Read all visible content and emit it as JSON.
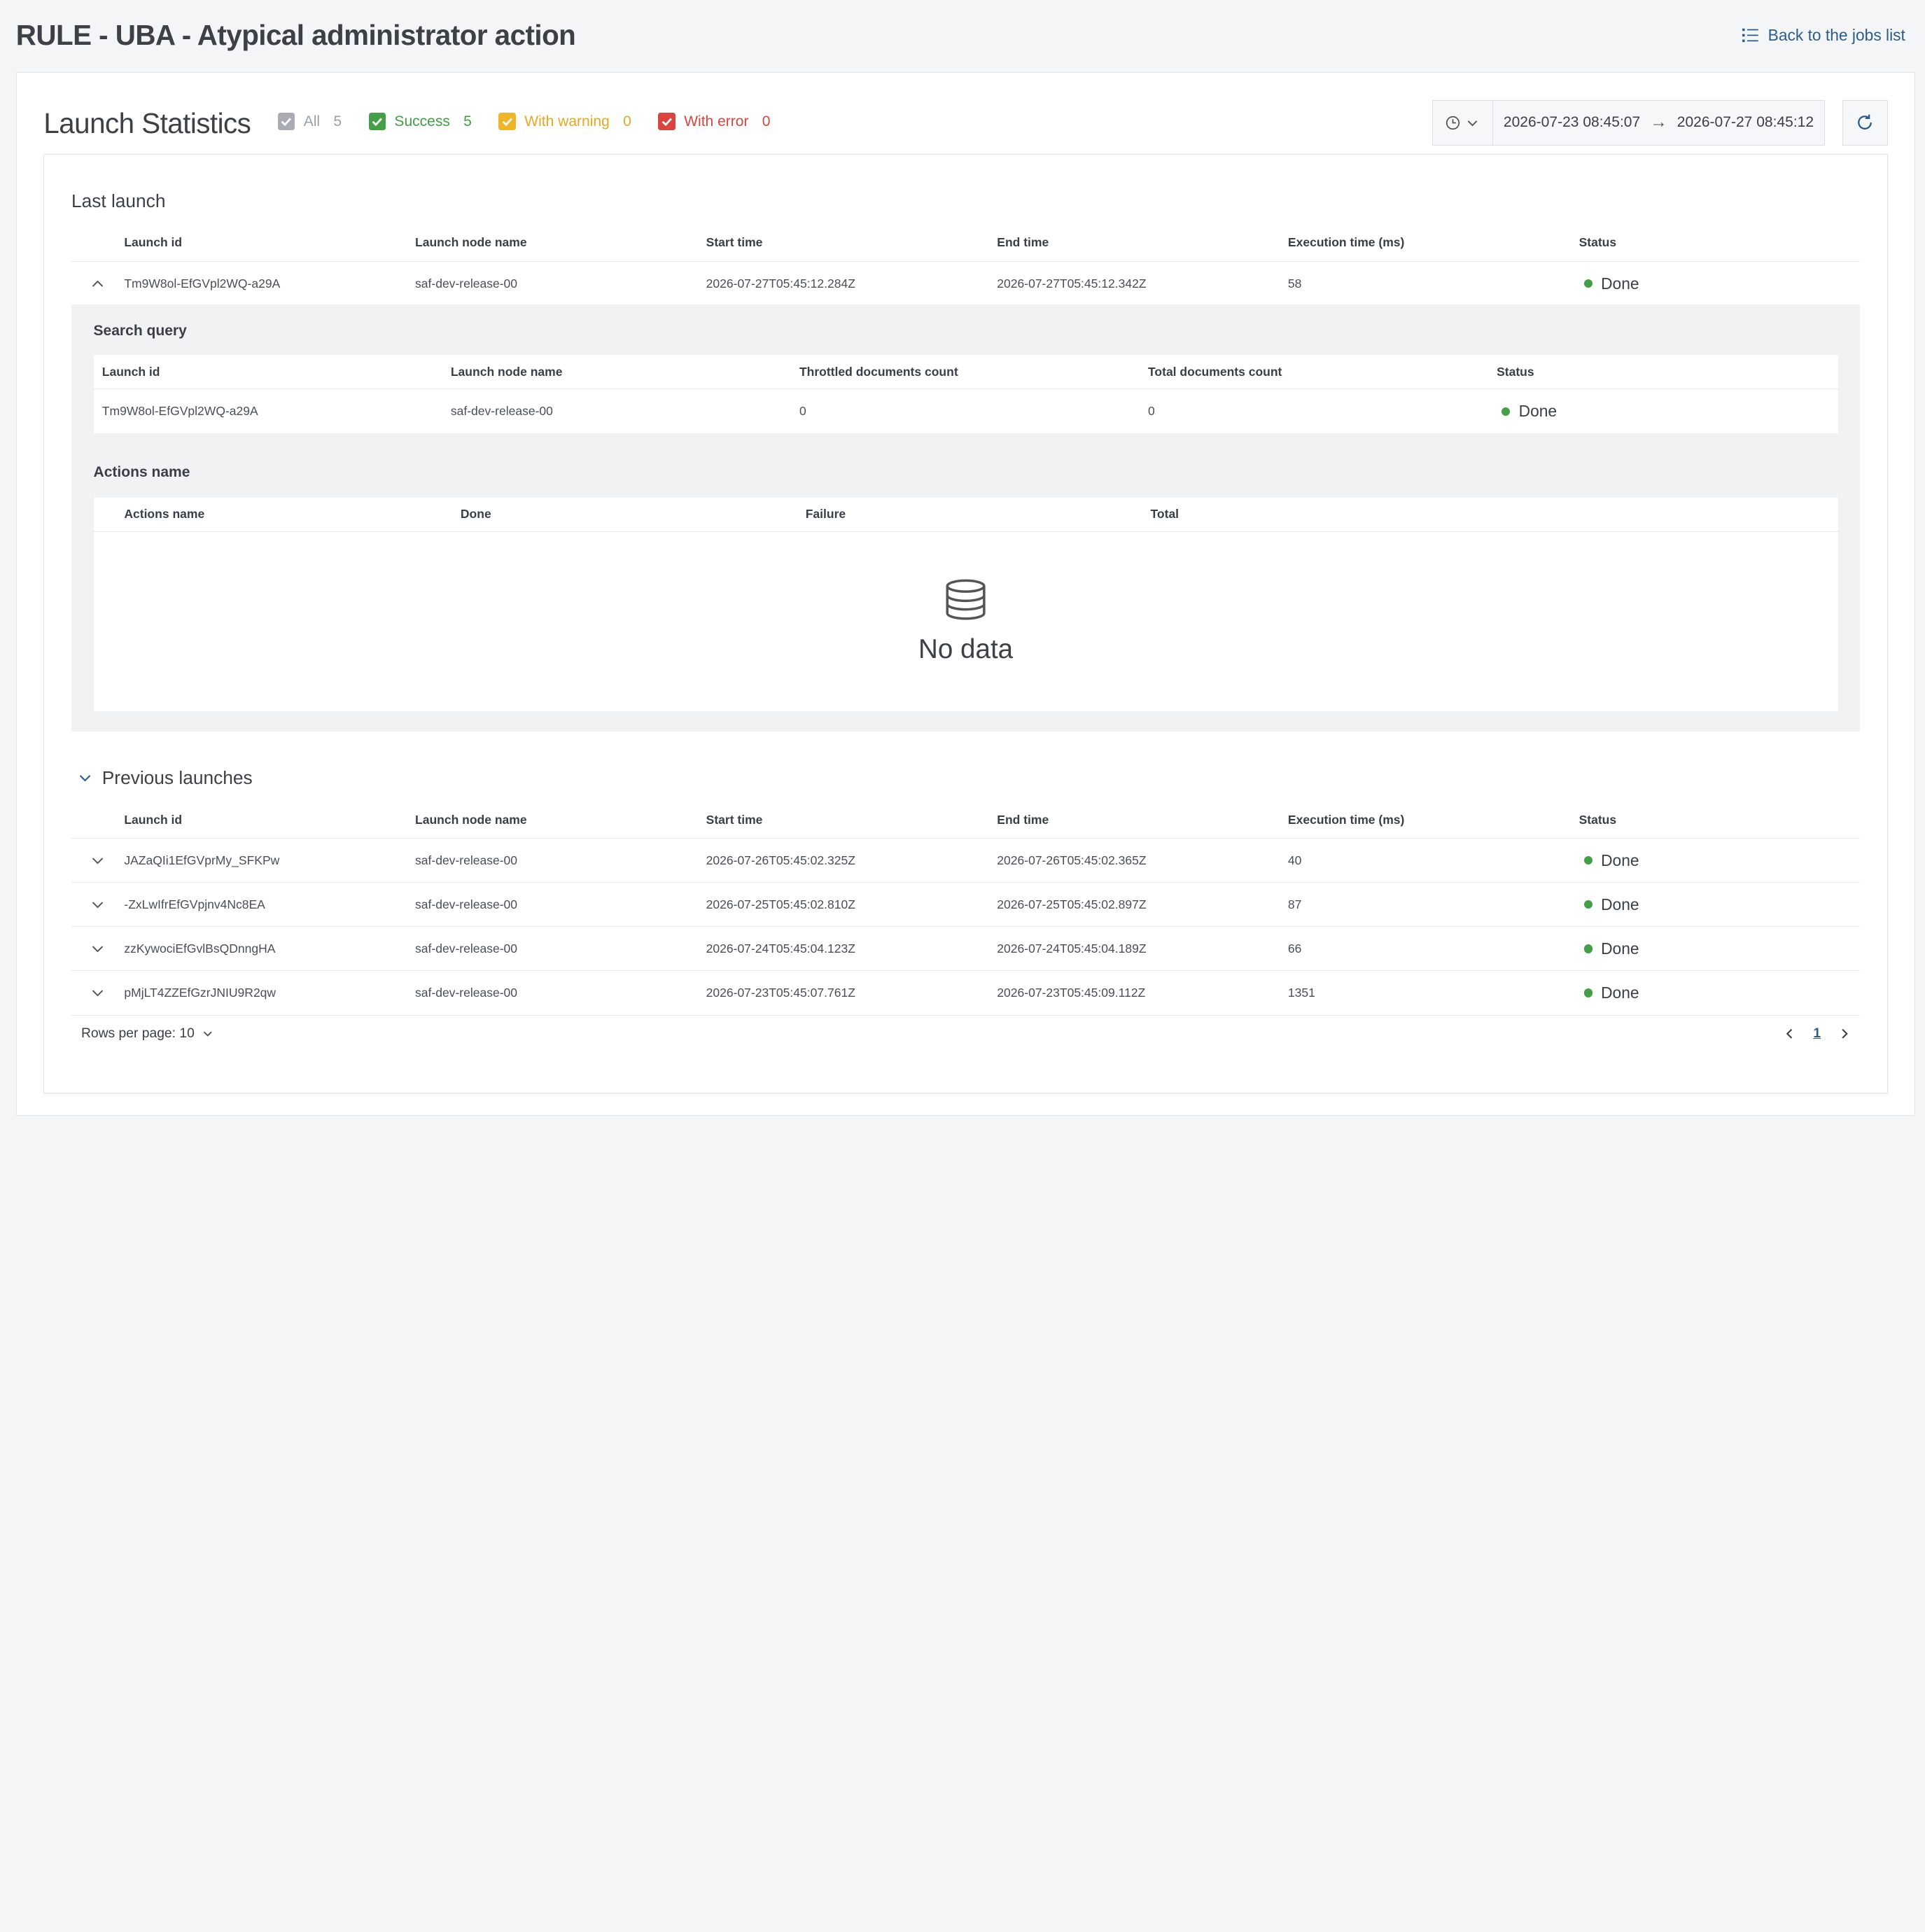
{
  "header": {
    "title": "RULE - UBA - Atypical administrator action",
    "back_label": "Back to the jobs list"
  },
  "stats": {
    "title": "Launch Statistics",
    "filters": {
      "all": {
        "label": "All",
        "count": "5"
      },
      "success": {
        "label": "Success",
        "count": "5"
      },
      "warning": {
        "label": "With warning",
        "count": "0"
      },
      "error": {
        "label": "With error",
        "count": "0"
      }
    },
    "date_from": "2026-07-23 08:45:07",
    "date_arrow": "→",
    "date_to": "2026-07-27 08:45:12"
  },
  "columns": {
    "launch_id": "Launch id",
    "node": "Launch node name",
    "start": "Start time",
    "end": "End time",
    "exec": "Execution time (ms)",
    "status": "Status"
  },
  "last_launch": {
    "title": "Last launch",
    "row": {
      "id": "Tm9W8ol-EfGVpl2WQ-a29A",
      "node": "saf-dev-release-00",
      "start": "2026-07-27T05:45:12.284Z",
      "end": "2026-07-27T05:45:12.342Z",
      "exec": "58",
      "status": "Done"
    },
    "search_query": {
      "title": "Search query",
      "columns": {
        "launch_id": "Launch id",
        "node": "Launch node name",
        "throttled": "Throttled documents count",
        "total": "Total documents count",
        "status": "Status"
      },
      "row": {
        "id": "Tm9W8ol-EfGVpl2WQ-a29A",
        "node": "saf-dev-release-00",
        "throttled": "0",
        "total": "0",
        "status": "Done"
      }
    },
    "actions": {
      "title": "Actions name",
      "columns": {
        "name": "Actions name",
        "done": "Done",
        "failure": "Failure",
        "total": "Total"
      },
      "empty_text": "No data"
    }
  },
  "previous": {
    "title": "Previous launches",
    "rows": [
      {
        "id": "JAZaQIi1EfGVprMy_SFKPw",
        "node": "saf-dev-release-00",
        "start": "2026-07-26T05:45:02.325Z",
        "end": "2026-07-26T05:45:02.365Z",
        "exec": "40",
        "status": "Done"
      },
      {
        "id": "-ZxLwIfrEfGVpjnv4Nc8EA",
        "node": "saf-dev-release-00",
        "start": "2026-07-25T05:45:02.810Z",
        "end": "2026-07-25T05:45:02.897Z",
        "exec": "87",
        "status": "Done"
      },
      {
        "id": "zzKywociEfGvlBsQDnngHA",
        "node": "saf-dev-release-00",
        "start": "2026-07-24T05:45:04.123Z",
        "end": "2026-07-24T05:45:04.189Z",
        "exec": "66",
        "status": "Done"
      },
      {
        "id": "pMjLT4ZZEfGzrJNIU9R2qw",
        "node": "saf-dev-release-00",
        "start": "2026-07-23T05:45:07.761Z",
        "end": "2026-07-23T05:45:09.112Z",
        "exec": "1351",
        "status": "Done"
      }
    ],
    "rows_per_page_label": "Rows per page: 10",
    "current_page": "1"
  }
}
